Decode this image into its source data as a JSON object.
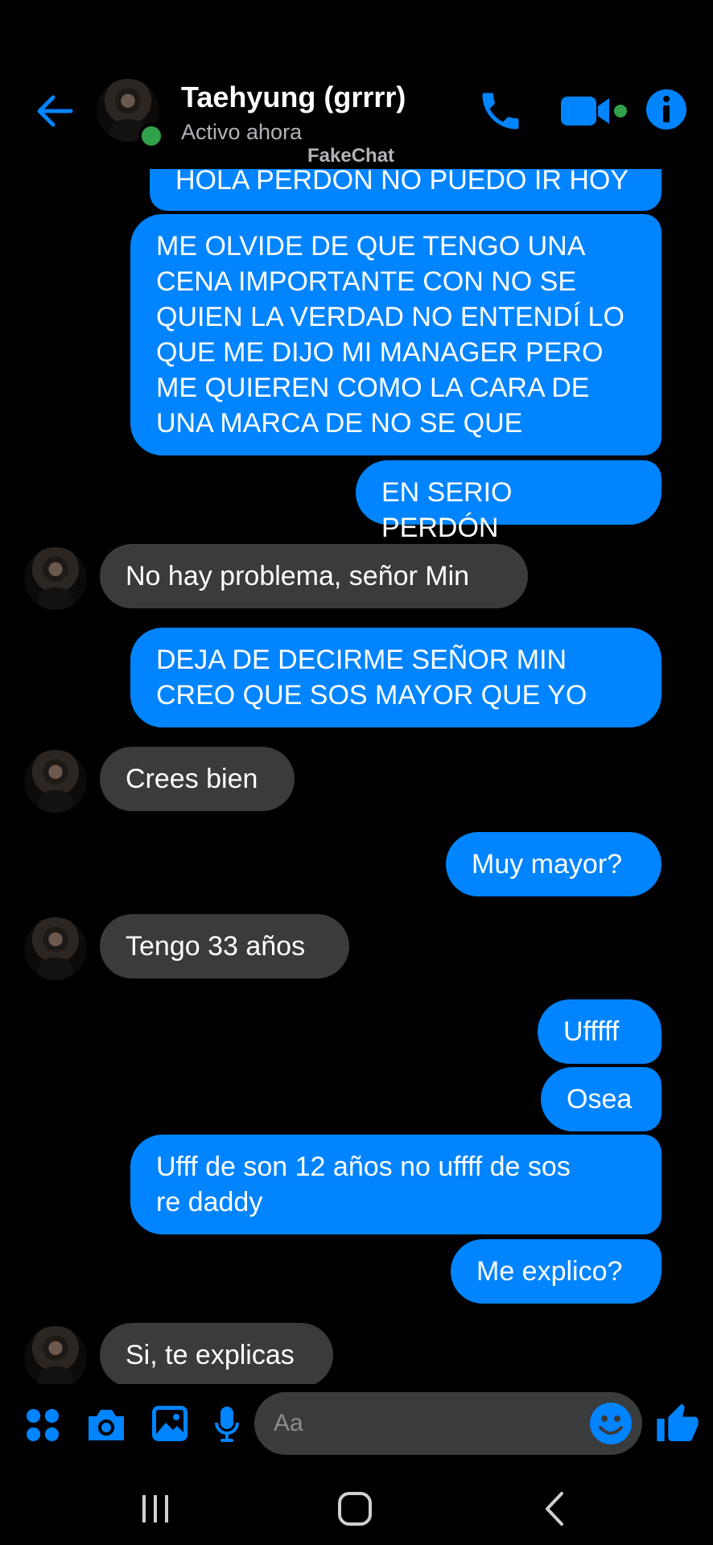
{
  "header": {
    "contact_name": "Taehyung (grrrr)",
    "status": "Activo ahora",
    "watermark": "FakeChat",
    "back_icon": "arrow-left-icon",
    "call_icon": "phone-icon",
    "video_icon": "video-camera-icon",
    "info_icon": "info-icon"
  },
  "messages": [
    {
      "from": "me",
      "text": "HOLA PERDON NO PUEDO IR HOY"
    },
    {
      "from": "me",
      "text": "ME OLVIDE DE QUE TENGO UNA\nCENA IMPORTANTE CON NO SE\nQUIEN LA VERDAD NO ENTENDÍ LO\nQUE ME DIJO MI MANAGER PERO\nME QUIEREN COMO LA CARA DE\nUNA MARCA DE NO SE QUE"
    },
    {
      "from": "me",
      "text": "EN SERIO PERDÓN"
    },
    {
      "from": "them",
      "text": "No hay problema, señor Min"
    },
    {
      "from": "me",
      "text": "DEJA DE DECIRME SEÑOR MIN\nCREO QUE SOS MAYOR QUE YO"
    },
    {
      "from": "them",
      "text": "Crees bien"
    },
    {
      "from": "me",
      "text": "Muy mayor?"
    },
    {
      "from": "them",
      "text": "Tengo 33 años"
    },
    {
      "from": "me",
      "text": "Ufffff"
    },
    {
      "from": "me",
      "text": "Osea"
    },
    {
      "from": "me",
      "text": "Ufff de son 12 años no uffff de sos\nre daddy"
    },
    {
      "from": "me",
      "text": "Me explico?"
    },
    {
      "from": "them",
      "text": "Si, te explicas"
    }
  ],
  "composer": {
    "placeholder": "Aa",
    "icons": [
      "apps-icon",
      "camera-icon",
      "gallery-icon",
      "microphone-icon",
      "emoji-icon",
      "thumbs-up-icon"
    ]
  },
  "navbar": {
    "icons": [
      "recent-apps-icon",
      "home-icon",
      "back-icon"
    ]
  },
  "colors": {
    "background": "#000000",
    "sent_bubble": "#0084ff",
    "received_bubble": "#3a3b3c",
    "accent": "#0084ff",
    "online": "#31a24c",
    "secondary_text": "#b0b3b8"
  }
}
